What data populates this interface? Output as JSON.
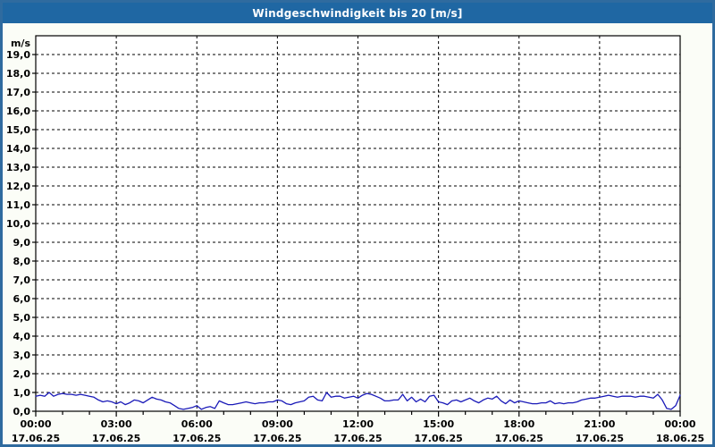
{
  "window": {
    "title": "Windgeschwindigkeit bis 20 [m/s]"
  },
  "colors": {
    "titlebar": "#1f67a3",
    "frame_border": "#2f6b9f",
    "background": "#fbfdf7",
    "plot_background": "#ffffff",
    "plot_frame": "#000000",
    "grid": "#000000",
    "tick_text": "#000000",
    "title_text": "#ffffff",
    "line": "#1a1ab8"
  },
  "chart_data": {
    "type": "line",
    "title": "Windgeschwindigkeit bis 20 [m/s]",
    "unit_label": "m/s",
    "ylim": [
      0,
      20
    ],
    "xlim_hours": [
      0,
      24
    ],
    "grid": "dashed, every 1.0 m/s horizontal and every 3 h vertical",
    "legend": "none",
    "y_tick_labels": [
      "0,0",
      "1,0",
      "2,0",
      "3,0",
      "4,0",
      "5,0",
      "6,0",
      "7,0",
      "8,0",
      "9,0",
      "10,0",
      "11,0",
      "12,0",
      "13,0",
      "14,0",
      "15,0",
      "16,0",
      "17,0",
      "18,0",
      "19,0"
    ],
    "x_ticks": [
      {
        "hour": 0,
        "time": "00:00",
        "date": "17.06.25"
      },
      {
        "hour": 3,
        "time": "03:00",
        "date": "17.06.25"
      },
      {
        "hour": 6,
        "time": "06:00",
        "date": "17.06.25"
      },
      {
        "hour": 9,
        "time": "09:00",
        "date": "17.06.25"
      },
      {
        "hour": 12,
        "time": "12:00",
        "date": "17.06.25"
      },
      {
        "hour": 15,
        "time": "15:00",
        "date": "17.06.25"
      },
      {
        "hour": 18,
        "time": "18:00",
        "date": "17.06.25"
      },
      {
        "hour": 21,
        "time": "21:00",
        "date": "17.06.25"
      },
      {
        "hour": 24,
        "time": "00:00",
        "date": "18.06.25"
      }
    ],
    "minor_x_tick_hours": 1,
    "series": [
      {
        "color": "#1a1ab8",
        "start_hour": 0,
        "step_minutes": 10,
        "values": [
          0.8,
          0.85,
          0.8,
          1.0,
          0.8,
          0.9,
          0.95,
          0.9,
          0.9,
          0.85,
          0.9,
          0.85,
          0.8,
          0.75,
          0.6,
          0.5,
          0.55,
          0.5,
          0.4,
          0.5,
          0.35,
          0.45,
          0.6,
          0.55,
          0.45,
          0.6,
          0.75,
          0.65,
          0.6,
          0.5,
          0.45,
          0.3,
          0.15,
          0.1,
          0.15,
          0.2,
          0.3,
          0.1,
          0.2,
          0.25,
          0.15,
          0.55,
          0.45,
          0.35,
          0.35,
          0.4,
          0.45,
          0.5,
          0.45,
          0.4,
          0.45,
          0.45,
          0.5,
          0.5,
          0.6,
          0.55,
          0.4,
          0.35,
          0.45,
          0.5,
          0.55,
          0.75,
          0.8,
          0.6,
          0.55,
          1.0,
          0.75,
          0.8,
          0.8,
          0.7,
          0.75,
          0.8,
          0.7,
          0.85,
          0.95,
          0.9,
          0.8,
          0.7,
          0.55,
          0.55,
          0.6,
          0.6,
          0.9,
          0.55,
          0.75,
          0.5,
          0.65,
          0.5,
          0.8,
          0.85,
          0.5,
          0.45,
          0.35,
          0.55,
          0.6,
          0.5,
          0.6,
          0.7,
          0.55,
          0.45,
          0.6,
          0.7,
          0.65,
          0.8,
          0.55,
          0.4,
          0.6,
          0.45,
          0.55,
          0.5,
          0.45,
          0.4,
          0.4,
          0.45,
          0.45,
          0.55,
          0.4,
          0.45,
          0.4,
          0.45,
          0.45,
          0.5,
          0.6,
          0.65,
          0.7,
          0.7,
          0.75,
          0.8,
          0.85,
          0.8,
          0.75,
          0.8,
          0.8,
          0.8,
          0.75,
          0.8,
          0.8,
          0.75,
          0.7,
          0.9,
          0.6,
          0.15,
          0.1,
          0.3,
          0.85
        ]
      }
    ]
  }
}
